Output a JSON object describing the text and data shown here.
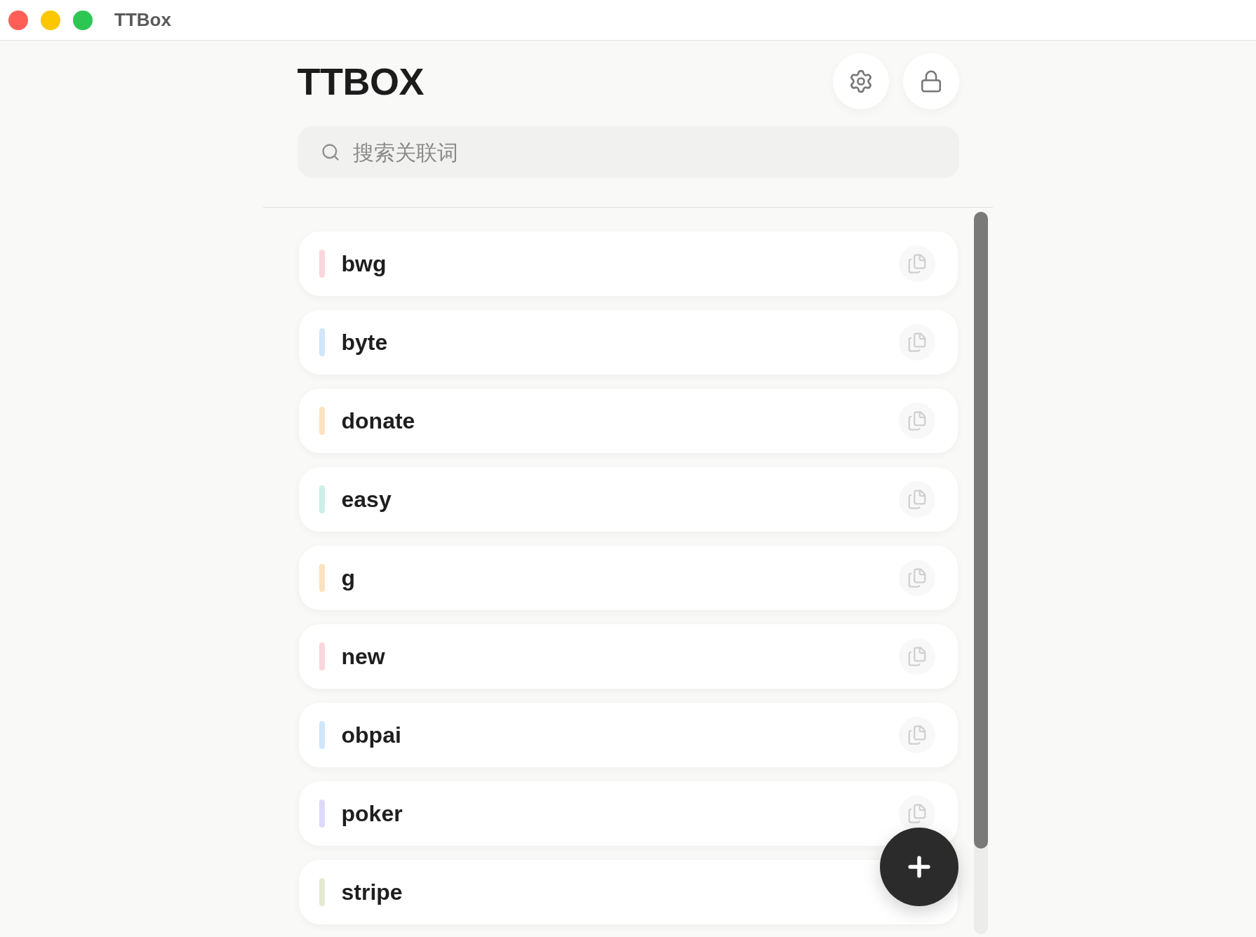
{
  "window": {
    "title": "TTBox"
  },
  "header": {
    "title": "TTBOX"
  },
  "search": {
    "placeholder": "搜索关联词"
  },
  "items": [
    {
      "name": "bwg",
      "color": "#fcd5df"
    },
    {
      "name": "byte",
      "color": "#cfe6fb"
    },
    {
      "name": "donate",
      "color": "#fde2bf"
    },
    {
      "name": "easy",
      "color": "#cdeee6"
    },
    {
      "name": "g",
      "color": "#fde2bf"
    },
    {
      "name": "new",
      "color": "#fcd5df"
    },
    {
      "name": "obpai",
      "color": "#cfe6fb"
    },
    {
      "name": "poker",
      "color": "#dedafc"
    },
    {
      "name": "stripe",
      "color": "#e4ead2"
    }
  ]
}
